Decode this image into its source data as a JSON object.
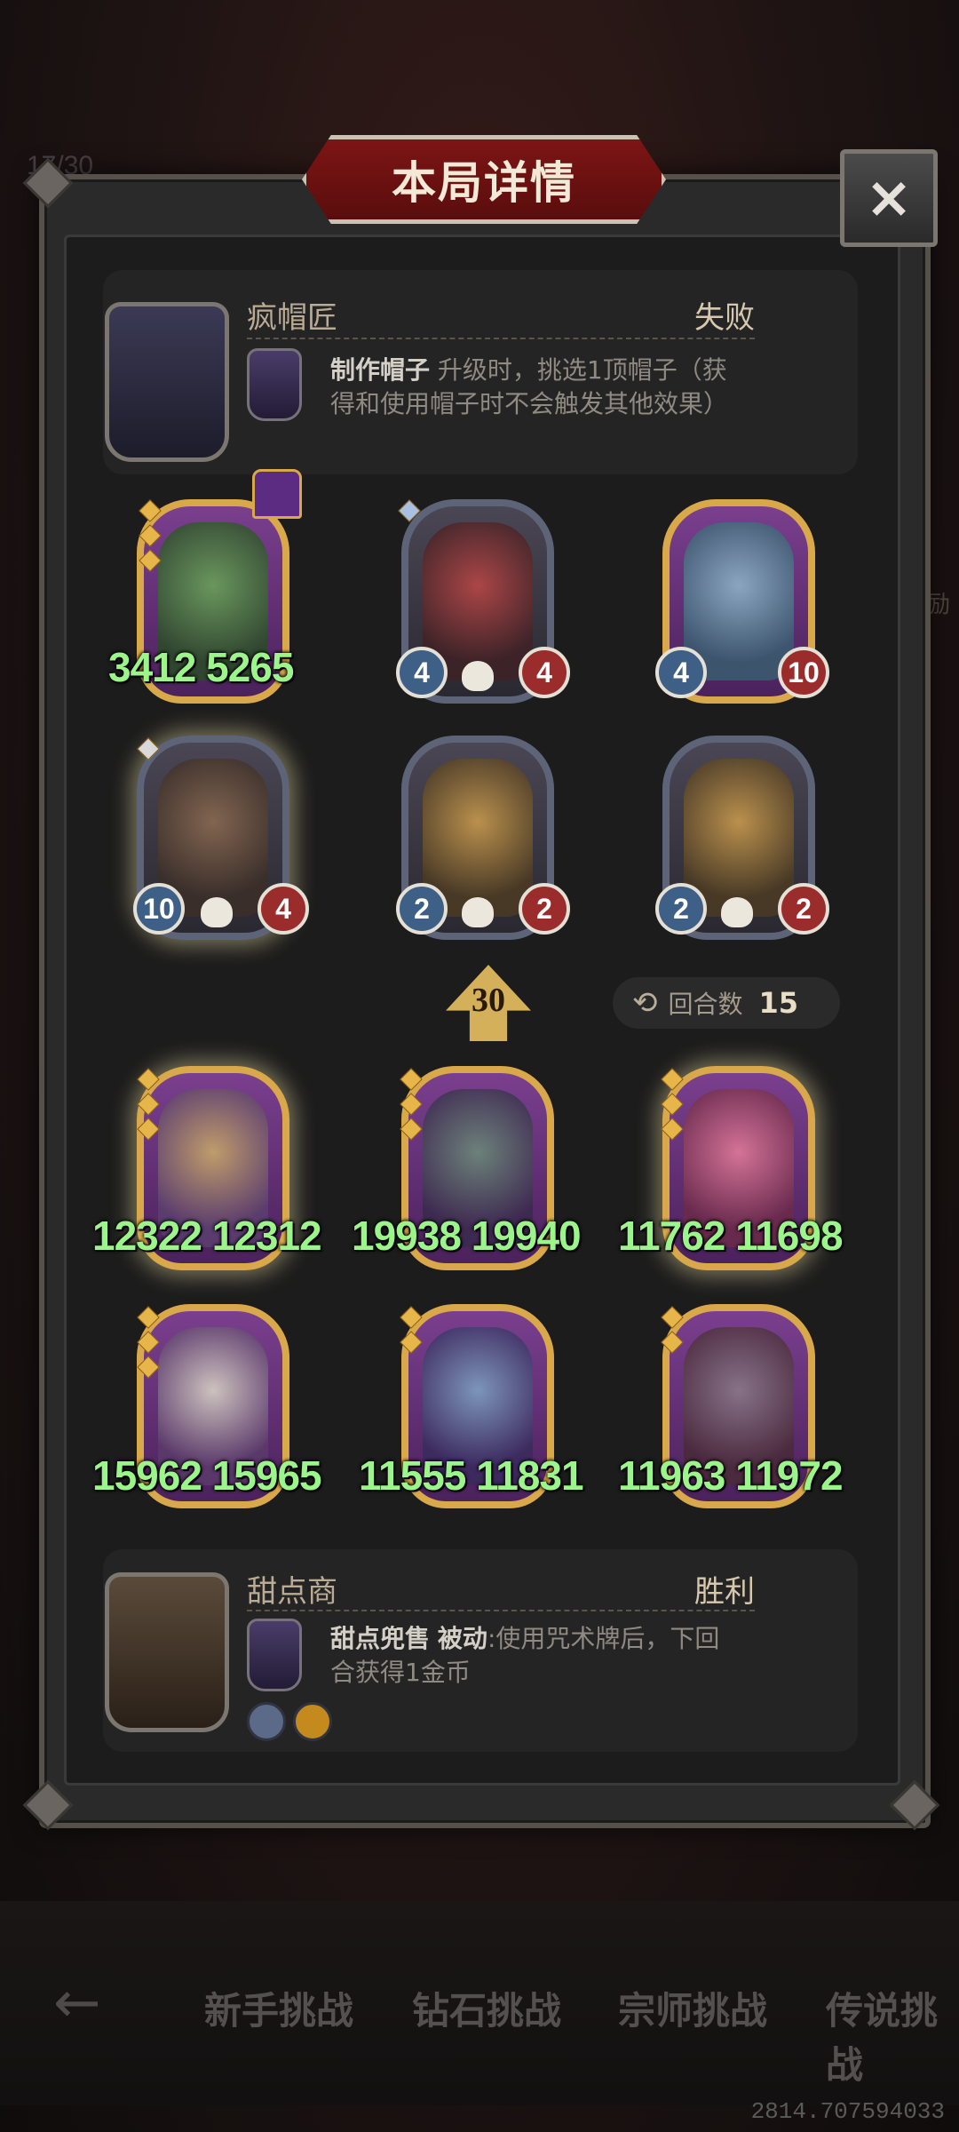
{
  "modal": {
    "title": "本局详情",
    "close_icon": "×"
  },
  "background": {
    "top_left_hint": "17/30",
    "right_hint": "励",
    "nav": {
      "back_icon": "←",
      "tabs": [
        "新手挑战",
        "钻石挑战",
        "宗师挑战",
        "传说挑战"
      ]
    },
    "coords": "2814.707594033"
  },
  "top_player": {
    "name": "疯帽匠",
    "result": "失败",
    "skill_name": "制作帽子",
    "skill_desc_1": "升级时，挑选1顶帽子（获",
    "skill_desc_2": "得和使用帽子时不会触发其他效果）"
  },
  "top_board": [
    {
      "name": "goblin-plant",
      "overlay": "3412 5265",
      "stars": 3
    },
    {
      "name": "clown",
      "atk": "4",
      "hp": "4",
      "stars": 1
    },
    {
      "name": "mouse-knight",
      "atk": "4",
      "hp": "10",
      "stars": 0
    },
    {
      "name": "scarecrow-owl",
      "atk": "10",
      "hp": "4",
      "stars": 1
    },
    {
      "name": "pinocchio",
      "atk": "2",
      "hp": "2",
      "stars": 0
    },
    {
      "name": "pinocchio",
      "atk": "2",
      "hp": "2",
      "stars": 0
    }
  ],
  "middle": {
    "level": "30",
    "turn_label": "回合数",
    "turn_value": "15"
  },
  "bottom_board": [
    {
      "name": "straw-hat-puppet",
      "overlay": "12322 12312",
      "stars": 3
    },
    {
      "name": "mushroom-creature",
      "overlay": "19938 19940",
      "stars": 3
    },
    {
      "name": "pink-lady",
      "overlay": "11762 11698",
      "stars": 3
    },
    {
      "name": "husky-dog",
      "overlay": "15962 15965",
      "stars": 3
    },
    {
      "name": "elf-woman",
      "overlay": "11555 11831",
      "stars": 3
    },
    {
      "name": "rat-monster",
      "overlay": "11963 11972",
      "stars": 3
    }
  ],
  "bottom_player": {
    "name": "甜点商",
    "result": "胜利",
    "skill_name": "甜点兜售",
    "skill_passive": "被动",
    "skill_desc_1": ":使用咒术牌后，下回",
    "skill_desc_2": "合获得1金币"
  }
}
